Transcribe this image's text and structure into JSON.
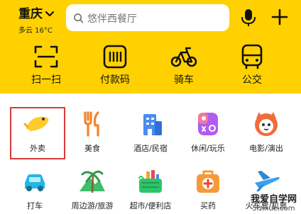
{
  "header": {
    "city": "重庆",
    "weather": "多云 16°C",
    "search_placeholder": "悠伴西餐厅"
  },
  "quick_actions": [
    {
      "label": "扫一扫",
      "icon": "scan-icon"
    },
    {
      "label": "付款码",
      "icon": "barcode-icon"
    },
    {
      "label": "骑车",
      "icon": "bike-icon"
    },
    {
      "label": "公交",
      "icon": "bus-icon"
    }
  ],
  "categories": [
    {
      "label": "外卖",
      "icon": "takeout-icon"
    },
    {
      "label": "美食",
      "icon": "food-icon"
    },
    {
      "label": "酒店/民宿",
      "icon": "hotel-icon"
    },
    {
      "label": "休闲/玩乐",
      "icon": "leisure-icon"
    },
    {
      "label": "电影/演出",
      "icon": "movie-icon"
    },
    {
      "label": "打车",
      "icon": "taxi-icon"
    },
    {
      "label": "周边游/旅游",
      "icon": "travel-icon"
    },
    {
      "label": "超市/便利店",
      "icon": "supermarket-icon"
    },
    {
      "label": "买药",
      "icon": "medicine-icon"
    },
    {
      "label": "火车票/机票",
      "icon": "plane-icon"
    }
  ],
  "watermark": {
    "line1": "我爱自学网",
    "line2": "5izixue.com"
  },
  "colors": {
    "brand_yellow": "#FFD100",
    "highlight_red": "#D93A3A"
  }
}
